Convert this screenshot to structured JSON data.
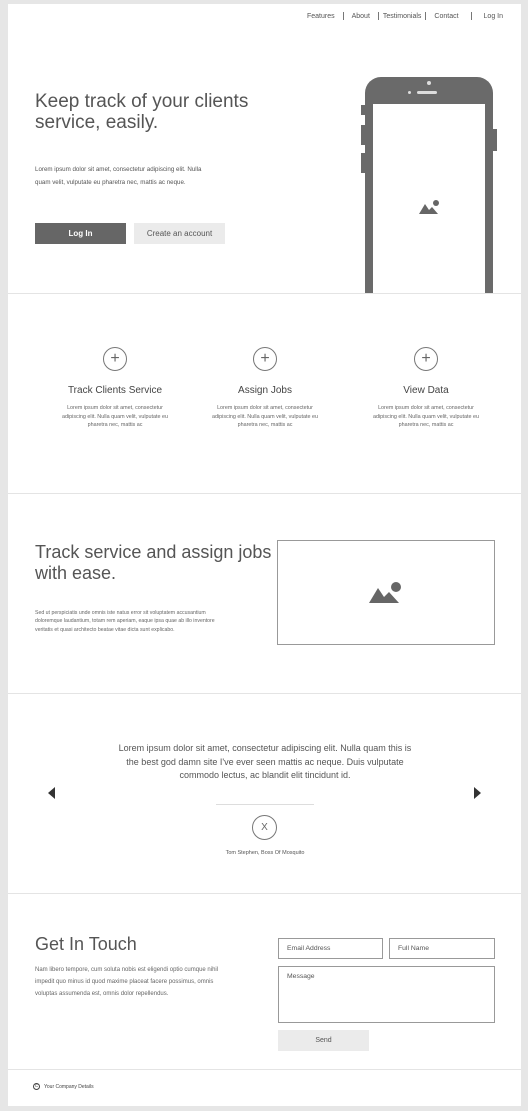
{
  "nav": {
    "items": [
      "Features",
      "About",
      "Testimonials",
      "Contact",
      "Log In"
    ]
  },
  "hero": {
    "title": "Keep track of your clients service, easily.",
    "text": "Lorem ipsum dolor sit amet, consectetur adipiscing elit. Nulla quam velit, vulputate eu pharetra nec, mattis ac neque.",
    "login_label": "Log In",
    "create_label": "Create an account"
  },
  "features": [
    {
      "title": "Track Clients Service",
      "text": "Lorem ipsum dolor sit amet, consectetur adipiscing elit. Nulla quam velit, vulputate eu pharetra nec, mattis ac"
    },
    {
      "title": "Assign Jobs",
      "text": "Lorem ipsum dolor sit amet, consectetur adipiscing elit. Nulla quam velit, vulputate eu pharetra nec, mattis ac"
    },
    {
      "title": "View Data",
      "text": "Lorem ipsum dolor sit amet, consectetur adipiscing elit. Nulla quam velit, vulputate eu pharetra nec, mattis ac"
    }
  ],
  "section3": {
    "title": "Track service and assign jobs with ease.",
    "text": "Sed ut perspiciatis unde omnis iste natus error sit voluptatem accusantium doloremque laudantium, totam rem aperiam, eaque ipsa quae ab illo inventore veritatis et quasi architecto beatae vitae dicta sunt explicabo."
  },
  "testimonial": {
    "quote": "Lorem ipsum dolor sit amet, consectetur adipiscing elit. Nulla quam this is the best god damn site I've ever seen  mattis ac neque. Duis vulputate commodo lectus, ac blandit elit tincidunt id.",
    "avatar_glyph": "X",
    "author": "Tom Stephen, Boss Of Mosquito"
  },
  "contact": {
    "title": "Get In Touch",
    "text": "Nam libero tempore, cum soluta nobis est eligendi optio cumque nihil impedit quo minus id quod maxime placeat facere possimus, omnis voluptas assumenda est, omnis dolor repellendus.",
    "email_placeholder": "Email Address",
    "name_placeholder": "Full Name",
    "message_placeholder": "Message",
    "send_label": "Send"
  },
  "footer": {
    "copyright_symbol": "C",
    "company": "Your Company Details"
  },
  "colors": {
    "button_dark": "#666666",
    "button_light": "#ebebeb",
    "phone": "#6a6a6a"
  }
}
